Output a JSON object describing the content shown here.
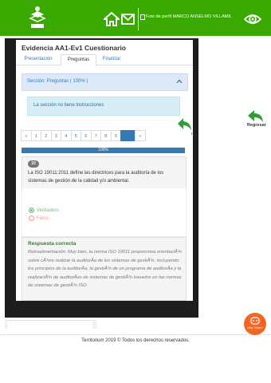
{
  "header": {
    "logo": "sena-logo",
    "home_icon": "home-icon",
    "mail_icon": "mail-icon",
    "profile_alt": "Foto de perfil MARCO ANSELMO VILLAMIL",
    "eye_icon": "eye-icon",
    "bg_color": "#39a900"
  },
  "quiz": {
    "title": "Evidencia AA1-Ev1 Cuestionario",
    "tabs": [
      {
        "label": "Presentación"
      },
      {
        "label": "Preguntas"
      },
      {
        "label": "Finalizar"
      }
    ],
    "active_tab": "Preguntas",
    "section_label": "Sección: Preguntas ( 100% )",
    "info": "La sección no tiene instrucciones",
    "pagination": [
      "«",
      "1",
      "2",
      "3",
      "4",
      "5",
      "6",
      "7",
      "8",
      "9",
      "",
      "»"
    ],
    "progress": {
      "label": "100%",
      "value": 100
    },
    "question": {
      "number": "10",
      "text": "La ISO 19011:2011 define las directrices para la auditoría de los sistemas de gestión de la calidad y/o ambiental."
    },
    "options": [
      {
        "label": "Verdadero",
        "selected": true
      },
      {
        "label": "Falso",
        "selected": false
      }
    ],
    "feedback": {
      "title": "Respuesta correcta",
      "text": "Retroalimentación: Muy bien, la norma ISO 19011 proporciona orientaciÃ³n sobre cÃ³mo realizar la auditorÃa de los sistemas de gestiÃ³n, incluyendo los principios de la auditorÃa, la gestiÃ³n de un programa de auditorÃa y la realizaciÃ³n de auditorÃas de sistemas de gestiÃ³n basados en las normas de sistemas de gestiÃ³n ISO."
    }
  },
  "side": {
    "back_label_clip": "r",
    "regresar": "Regresar",
    "arrow_color": "#2e9e3a"
  },
  "footer": "Territorium 2019 © Todos los derechos reservados.",
  "chat": {
    "label": "Hey Tomé!",
    "color": "#f26522"
  }
}
